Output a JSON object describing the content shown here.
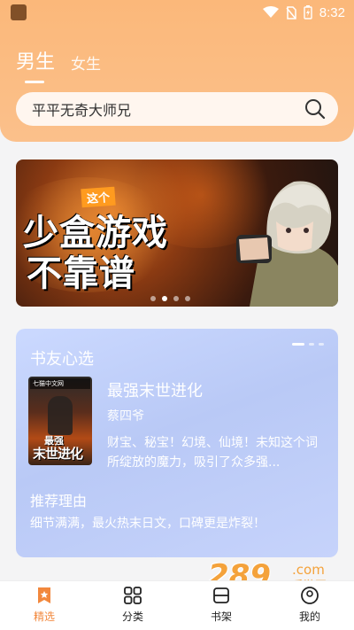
{
  "status_bar": {
    "time": "8:32"
  },
  "tabs": [
    {
      "label": "男生",
      "active": true
    },
    {
      "label": "女生",
      "active": false
    }
  ],
  "search": {
    "text": "平平无奇大师兄"
  },
  "banner": {
    "small": "这个",
    "line1": "少盒游戏",
    "line2": "不靠谱"
  },
  "picks": {
    "title": "书友心选",
    "book": {
      "title": "最强末世进化",
      "author": "蔡四爷",
      "description": "财宝、秘宝！幻境、仙境！未知这个词所绽放的魔力，吸引了众多强...",
      "cover_badge": "七猫中文网",
      "cover_title_top": "最强",
      "cover_title_bottom": "末世进化"
    },
    "reason_title": "推荐理由",
    "reason_text": "细节满满，最火热末日文，口碑更是炸裂！"
  },
  "bottom_nav": [
    {
      "label": "精选",
      "icon": "bookmark-star-icon",
      "active": true
    },
    {
      "label": "分类",
      "icon": "grid-icon",
      "active": false
    },
    {
      "label": "书架",
      "icon": "bookshelf-icon",
      "active": false
    },
    {
      "label": "我的",
      "icon": "profile-icon",
      "active": false
    }
  ],
  "watermark": {
    "number": "289",
    "domain": ".com",
    "sub": "手游网"
  },
  "colors": {
    "accent": "#f2883d",
    "header": "#fbb87a",
    "card": "#bfcdf8"
  }
}
